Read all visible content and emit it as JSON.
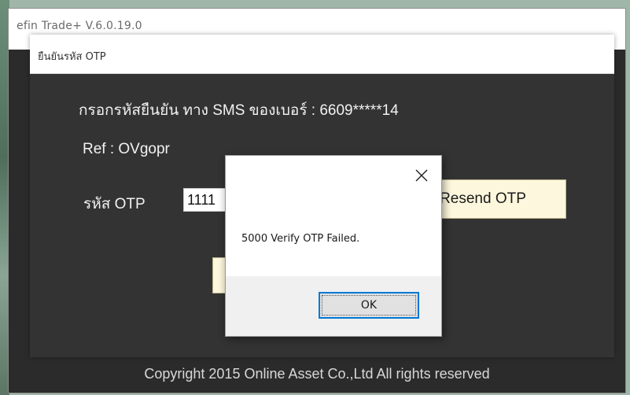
{
  "main_window": {
    "title": "efin Trade+ V.6.0.19.0",
    "copyright": "Copyright 2015 Online Asset Co.,Ltd  All rights reserved"
  },
  "otp_dialog": {
    "title": "ยืนยันรหัส OTP",
    "sms_text": "กรอกรหัสยืนยัน ทาง SMS ของเบอร์ : 6609*****14",
    "ref_text": "Ref : OVgopr",
    "otp_label": "รหัส OTP",
    "otp_value": "1111",
    "resend_label": "Resend OTP"
  },
  "message_box": {
    "message": "5000 Verify OTP Failed.",
    "ok_label": "OK",
    "close_icon": "close-icon"
  },
  "colors": {
    "dialog_bg": "#333333",
    "button_bg": "#fdf7dd",
    "focus_border": "#0078d7"
  }
}
